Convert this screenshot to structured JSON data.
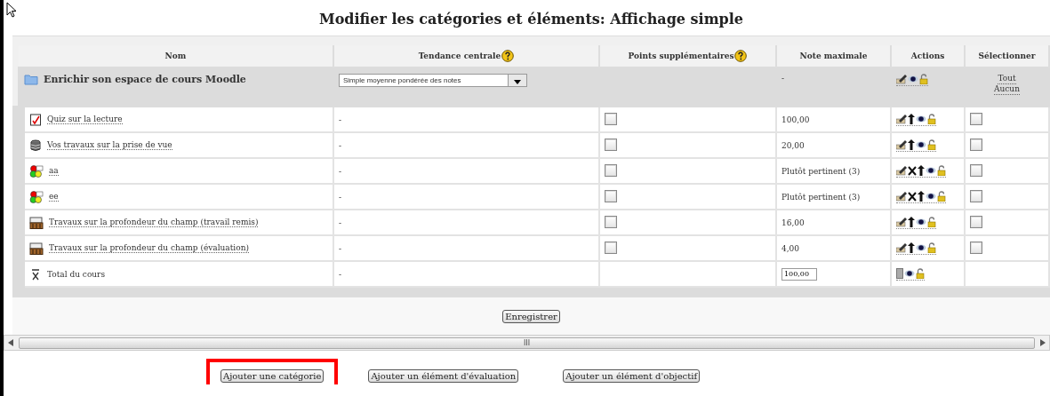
{
  "title": "Modifier les catégories et éléments: Affichage simple",
  "columns": [
    {
      "label": "Nom",
      "help": false
    },
    {
      "label": "Tendance centrale",
      "help": true
    },
    {
      "label": "Points supplémentaires",
      "help": true
    },
    {
      "label": "Note maximale",
      "help": false
    },
    {
      "label": "Actions",
      "help": false
    },
    {
      "label": "Sélectionner",
      "help": false
    }
  ],
  "category": {
    "name": "Enrichir son espace de cours Moodle",
    "aggregation": "Simple moyenne pondérée des notes",
    "max": "-",
    "select_all": "Tout",
    "select_none": "Aucun"
  },
  "rows": [
    {
      "kind": "quiz",
      "name": "Quiz sur la lecture",
      "aggregation": "-",
      "extra": false,
      "max": "100,00",
      "deletable": false,
      "selected": false
    },
    {
      "kind": "database",
      "name": "Vos travaux sur la prise de vue",
      "aggregation": "-",
      "extra": false,
      "max": "20,00",
      "deletable": false,
      "selected": false
    },
    {
      "kind": "scale",
      "name": "aa",
      "aggregation": "-",
      "extra": false,
      "max": "Plutôt pertinent (3)",
      "deletable": true,
      "selected": false
    },
    {
      "kind": "scale",
      "name": "ee",
      "aggregation": "-",
      "extra": false,
      "max": "Plutôt pertinent (3)",
      "deletable": true,
      "selected": false
    },
    {
      "kind": "assignment",
      "name": "Travaux sur la profondeur du champ (travail remis)",
      "aggregation": "-",
      "extra": false,
      "max": "16,00",
      "deletable": false,
      "selected": false
    },
    {
      "kind": "assignment",
      "name": "Travaux sur la profondeur du champ (évaluation)",
      "aggregation": "-",
      "extra": false,
      "max": "4,00",
      "deletable": false,
      "selected": false
    }
  ],
  "total": {
    "name": "Total du cours",
    "aggregation": "-",
    "max": "100,00"
  },
  "save": "Enregistrer",
  "scroll_grip": "III",
  "buttons": [
    {
      "label": "Ajouter une catégorie",
      "highlighted": true
    },
    {
      "label": "Ajouter un élément d'évaluation",
      "highlighted": false
    },
    {
      "label": "Ajouter un élément d'objectif",
      "highlighted": false
    }
  ]
}
